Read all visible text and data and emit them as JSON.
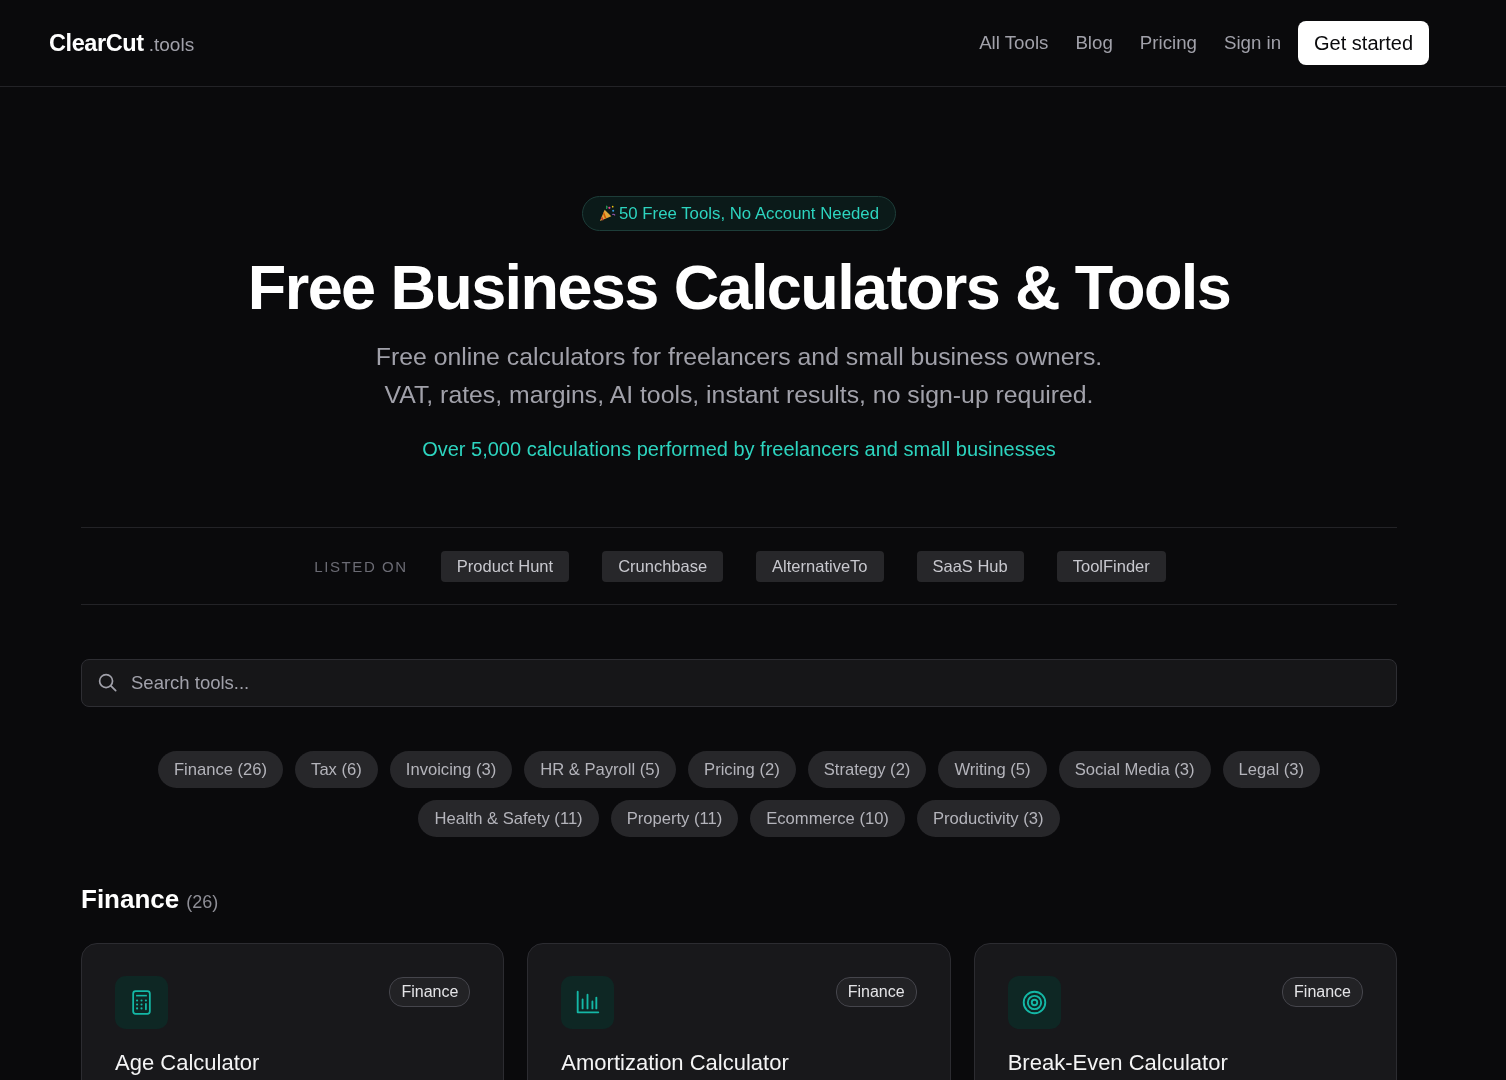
{
  "header": {
    "logo": {
      "name": "ClearCut",
      "suffix": ".tools"
    },
    "nav": [
      "All Tools",
      "Blog",
      "Pricing",
      "Sign in"
    ],
    "cta": "Get started"
  },
  "hero": {
    "badge": "50 Free Tools, No Account Needed",
    "title": "Free Business Calculators & Tools",
    "subtitle_lines": [
      "Free online calculators for freelancers and small business owners.",
      "VAT, rates, margins, AI tools, instant results, no sign-up required."
    ],
    "stat": "Over 5,000 calculations performed by freelancers and small businesses"
  },
  "listed_on": {
    "label": "LISTED ON",
    "sites": [
      "Product Hunt",
      "Crunchbase",
      "AlternativeTo",
      "SaaS Hub",
      "ToolFinder"
    ]
  },
  "search": {
    "placeholder": "Search tools..."
  },
  "category_filters": [
    "Finance (26)",
    "Tax (6)",
    "Invoicing (3)",
    "HR & Payroll (5)",
    "Pricing (2)",
    "Strategy (2)",
    "Writing (5)",
    "Social Media (3)",
    "Legal (3)",
    "Health & Safety (11)",
    "Property (11)",
    "Ecommerce (10)",
    "Productivity (3)"
  ],
  "section": {
    "title": "Finance",
    "count": "(26)",
    "cards": [
      {
        "badge": "Finance",
        "title": "Age Calculator"
      },
      {
        "badge": "Finance",
        "title": "Amortization Calculator"
      },
      {
        "badge": "Finance",
        "title": "Break-Even Calculator"
      }
    ]
  }
}
